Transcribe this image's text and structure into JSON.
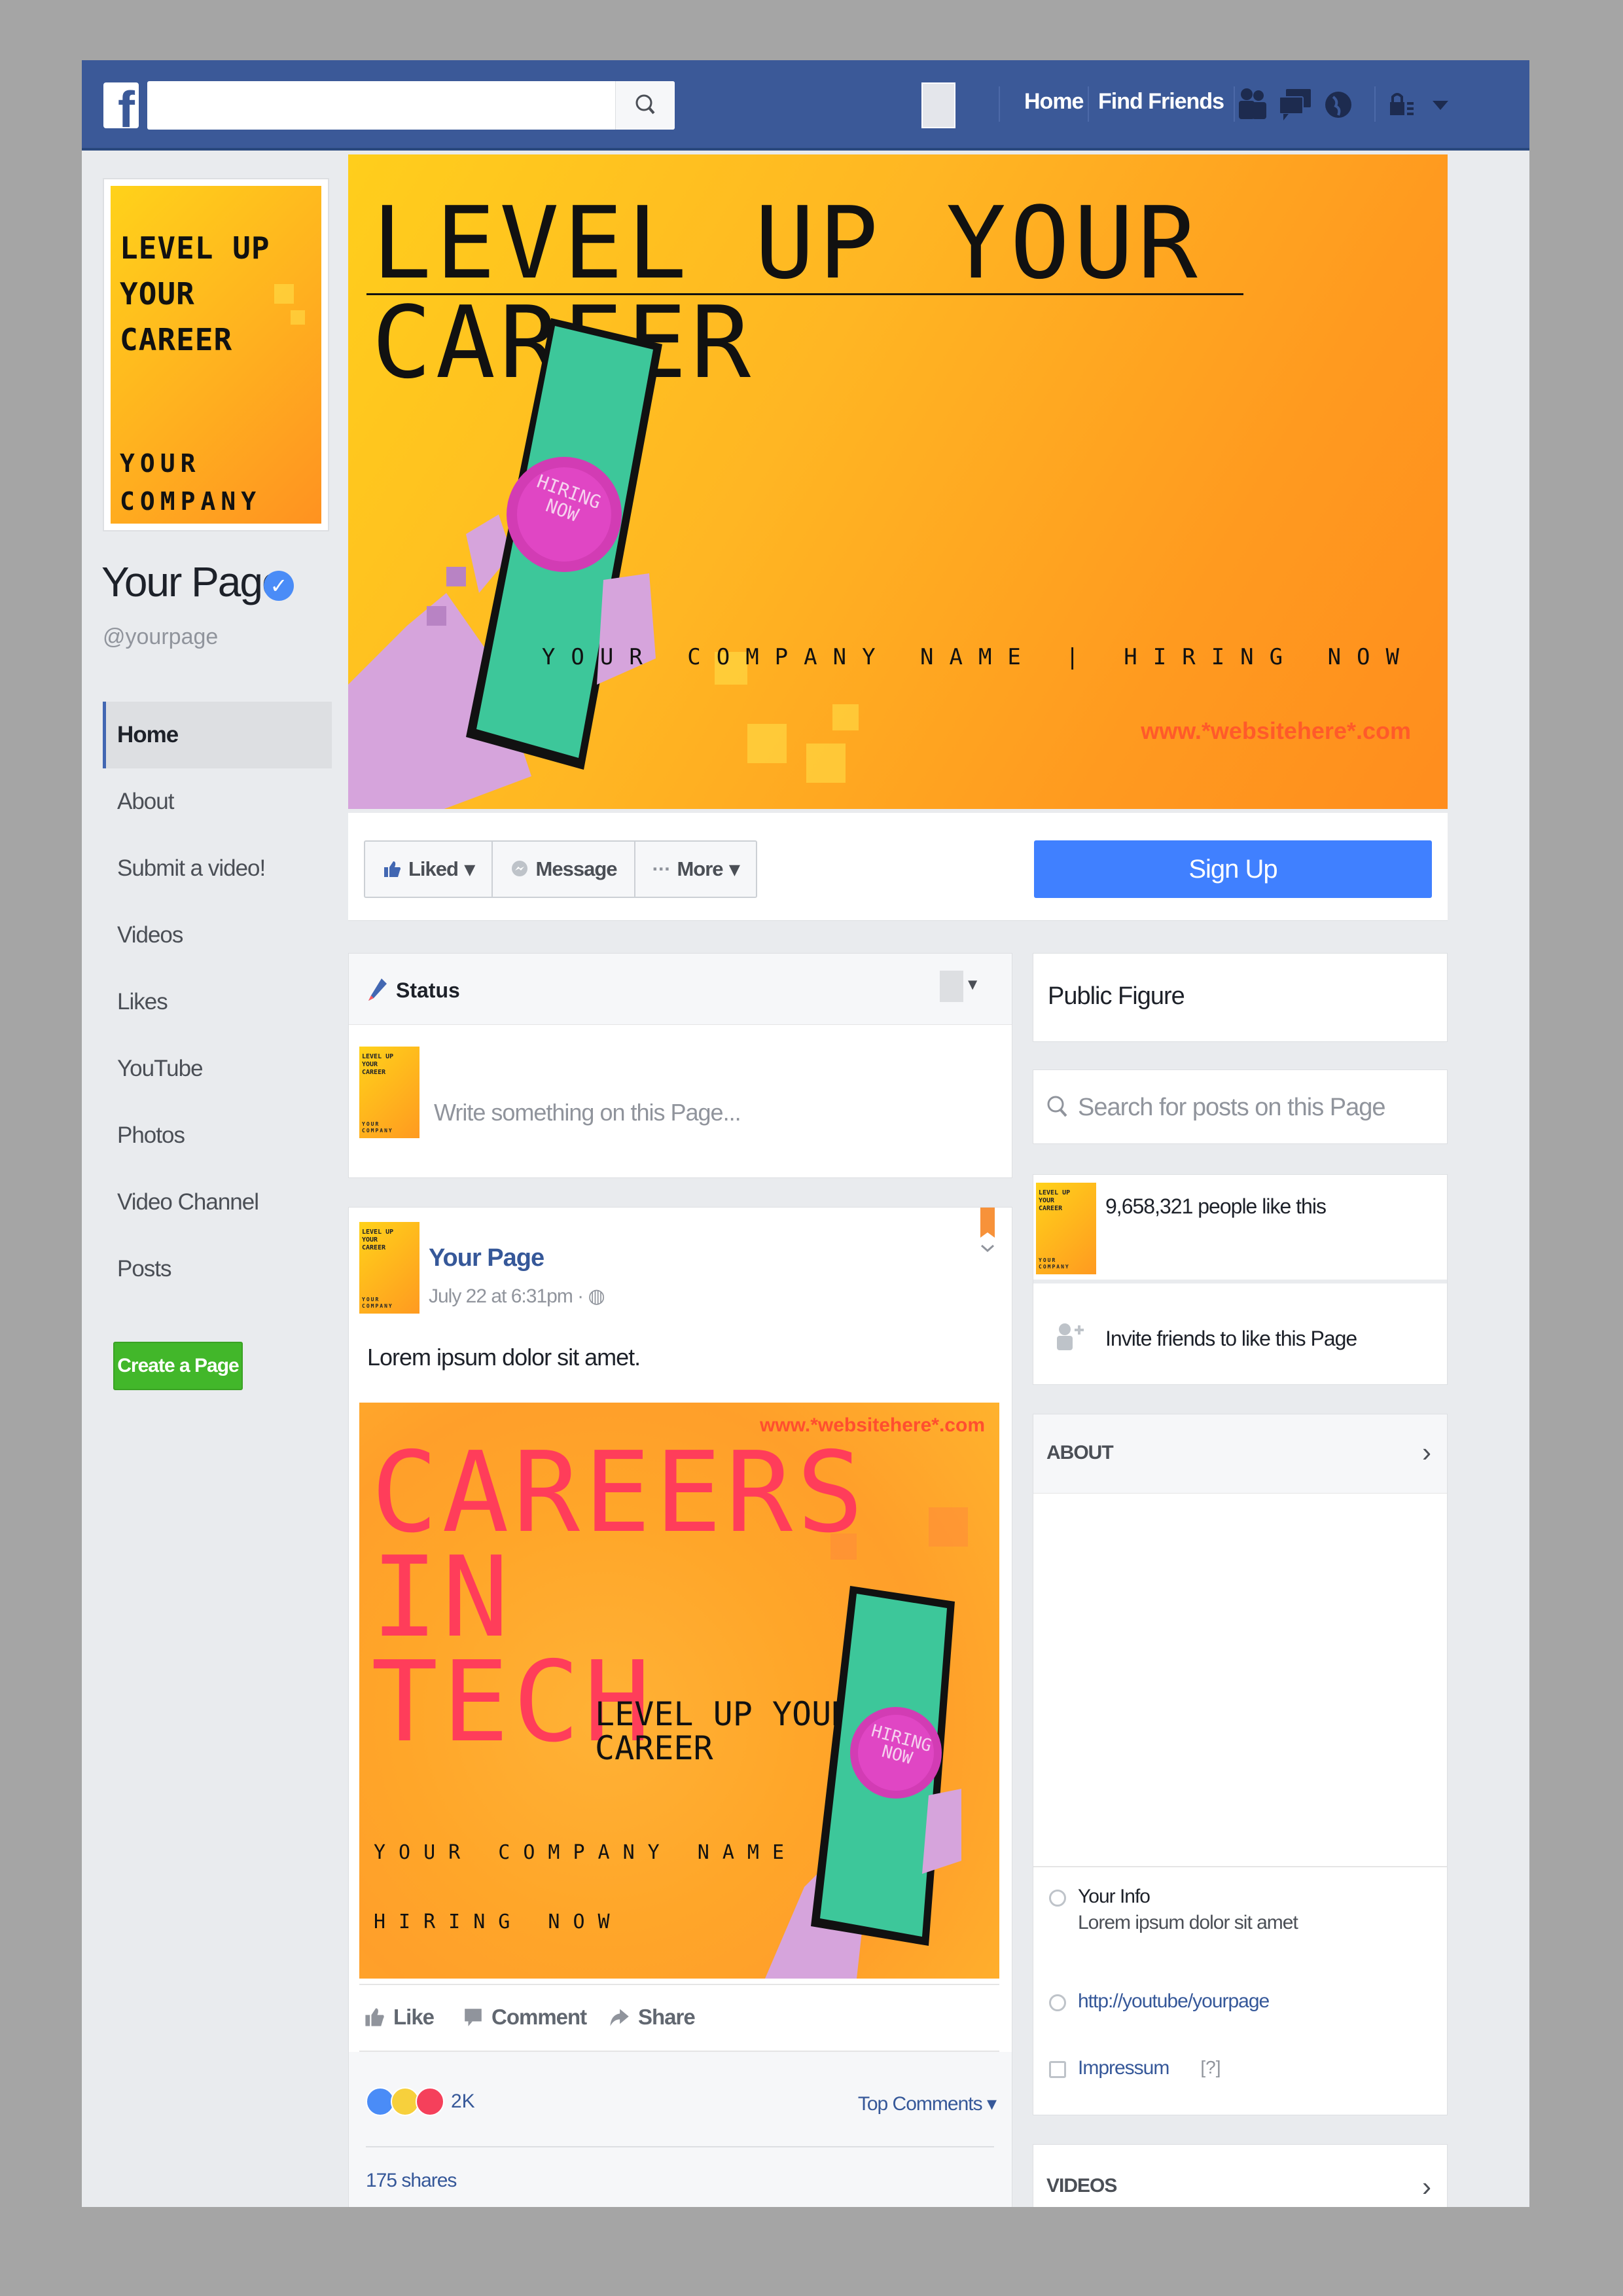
{
  "topbar": {
    "logo_letter": "f",
    "search_placeholder": "",
    "nav_home": "Home",
    "nav_find_friends": "Find Friends",
    "brand_color": "#3b5998"
  },
  "profile": {
    "pic_title": "LEVEL UP\nYOUR\nCAREER",
    "pic_sub": "YOUR\nCOMPANY",
    "name": "Your Page",
    "verified_mark": "✓",
    "handle": "@yourpage"
  },
  "sidebar": {
    "items": [
      {
        "label": "Home",
        "active": true
      },
      {
        "label": "About"
      },
      {
        "label": "Submit a video!"
      },
      {
        "label": "Videos"
      },
      {
        "label": "Likes"
      },
      {
        "label": "YouTube"
      },
      {
        "label": "Photos"
      },
      {
        "label": "Video Channel"
      },
      {
        "label": "Posts"
      }
    ],
    "create_page": "Create a Page"
  },
  "cover": {
    "title": "LEVEL UP YOUR CAREER",
    "phone_text": "HIRING\nNOW",
    "company_line": "YOUR COMPANY NAME | HIRING NOW",
    "website": "www.*websitehere*.com"
  },
  "actions": {
    "liked": "Liked",
    "message": "Message",
    "more": "More",
    "sign_up": "Sign Up",
    "signup_color": "#4080ff"
  },
  "status": {
    "tab_label": "Status",
    "placeholder": "Write something on this Page...",
    "thumb_title": "LEVEL UP\nYOUR\nCAREER",
    "thumb_sub": "YOUR\nCOMPANY"
  },
  "post": {
    "author": "Your Page",
    "time": "July 22 at 6:31pm · ",
    "text": "Lorem ipsum dolor sit amet.",
    "image": {
      "website": "www.*websitehere*.com",
      "headline": "CAREERS\nIN\nTECH",
      "subhead": "LEVEL UP YOUR\nCAREER",
      "company": "YOUR COMPANY NAME",
      "hiring": "HIRING NOW",
      "phone_text": "HIRING\nNOW"
    },
    "like": "Like",
    "comment": "Comment",
    "share": "Share",
    "reaction_count": "2K",
    "top_comments": "Top Comments",
    "shares": "175 shares"
  },
  "right": {
    "category": "Public Figure",
    "search_placeholder": "Search for posts on this Page",
    "likes_count": "9,658,321 people like this",
    "invite": "Invite friends to like this Page",
    "about_title": "ABOUT",
    "info_title": "Your Info",
    "info_desc": "Lorem ipsum dolor sit amet",
    "youtube_link": "http://youtube/yourpage",
    "impressum": "Impressum",
    "impressum_q": "[?]",
    "videos_title": "VIDEOS"
  }
}
